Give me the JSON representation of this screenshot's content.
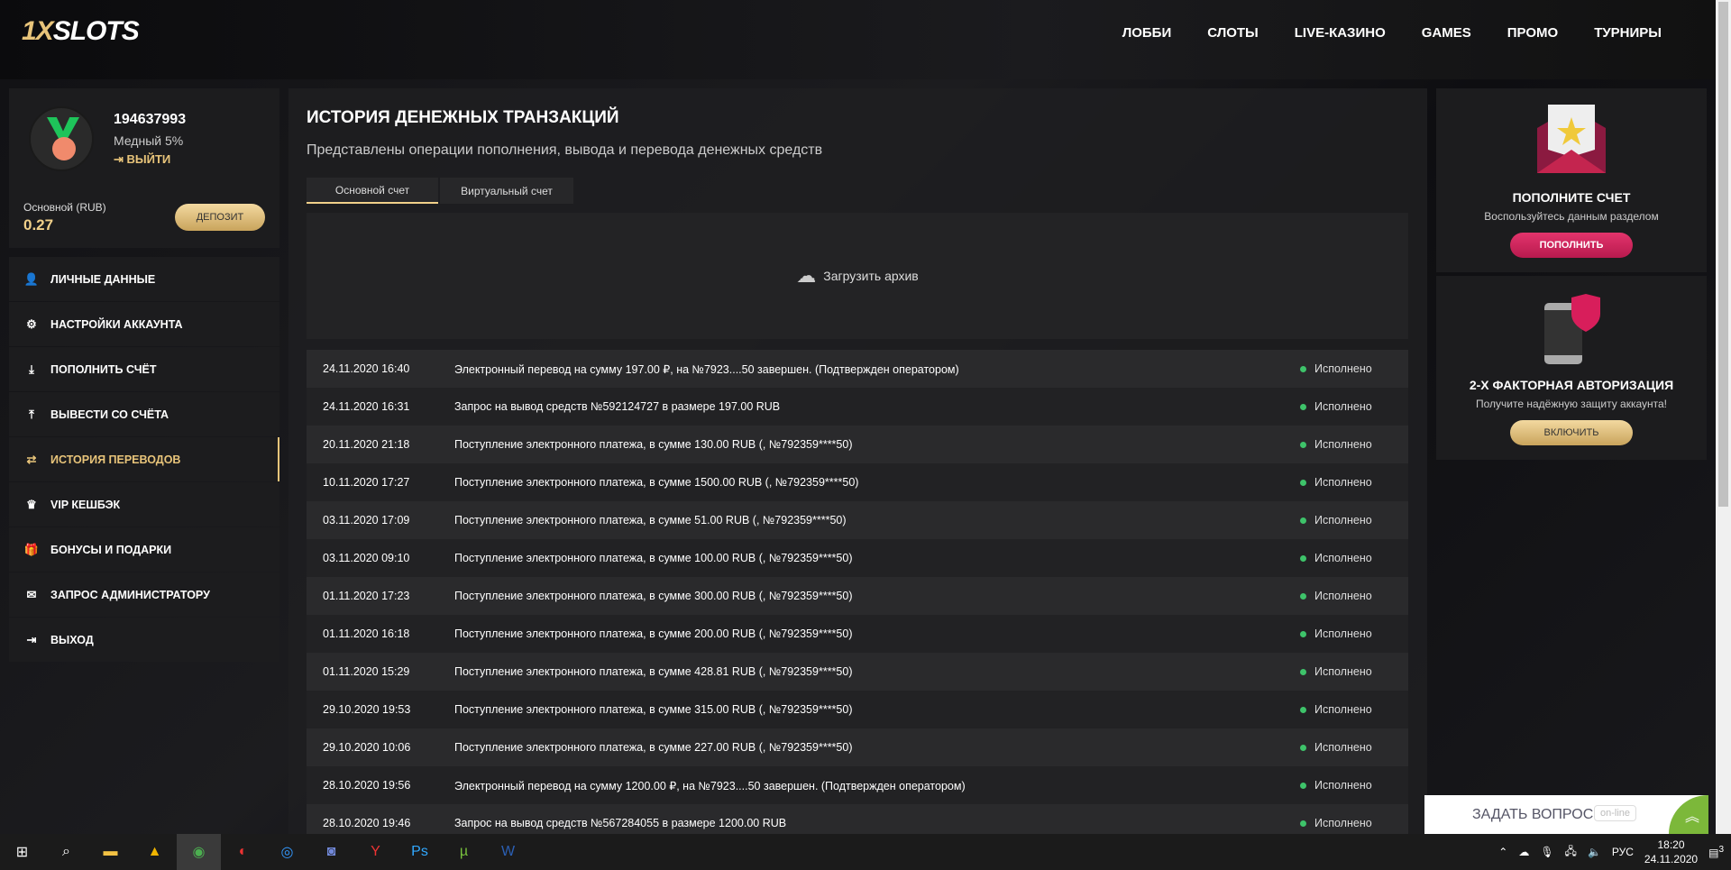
{
  "header": {
    "logo": "1XSLOTS",
    "nav": [
      "ЛОББИ",
      "СЛОТЫ",
      "LIVE-КАЗИНО",
      "GAMES",
      "ПРОМО",
      "ТУРНИРЫ"
    ]
  },
  "profile": {
    "id": "194637993",
    "rank": "Медный 5%",
    "logout": "ВЫЙТИ",
    "balance_label": "Основной (RUB)",
    "balance": "0.27",
    "deposit": "ДЕПОЗИТ"
  },
  "menu": [
    {
      "label": "ЛИЧНЫЕ ДАННЫЕ",
      "icon": "user-add-icon",
      "g": "👤"
    },
    {
      "label": "НАСТРОЙКИ АККАУНТА",
      "icon": "gears-icon",
      "g": "⚙"
    },
    {
      "label": "ПОПОЛНИТЬ СЧЁТ",
      "icon": "download-icon",
      "g": "⤓"
    },
    {
      "label": "ВЫВЕСТИ СО СЧЁТА",
      "icon": "upload-icon",
      "g": "⤒"
    },
    {
      "label": "ИСТОРИЯ ПЕРЕВОДОВ",
      "icon": "transfer-icon",
      "g": "⇄",
      "active": true
    },
    {
      "label": "VIP КЕШБЭК",
      "icon": "crown-icon",
      "g": "♛"
    },
    {
      "label": "БОНУСЫ И ПОДАРКИ",
      "icon": "gift-icon",
      "g": "🎁"
    },
    {
      "label": "ЗАПРОС АДМИНИСТРАТОРУ",
      "icon": "envelope-icon",
      "g": "✉"
    },
    {
      "label": "ВЫХОД",
      "icon": "sign-out-icon",
      "g": "⇥"
    }
  ],
  "main": {
    "title": "ИСТОРИЯ ДЕНЕЖНЫХ ТРАНЗАКЦИЙ",
    "subtitle": "Представлены операции пополнения, вывода и перевода денежных средств",
    "tabs": [
      "Основной счет",
      "Виртуальный счет"
    ],
    "archive": "Загрузить архив",
    "rows": [
      {
        "date": "24.11.2020 16:40",
        "text": "Электронный перевод на сумму 197.00 ₽, на №7923....50 завершен. (Подтвержден оператором)",
        "status": "Исполнено"
      },
      {
        "date": "24.11.2020 16:31",
        "text": "Запрос на вывод средств №592124727 в размере 197.00 RUB",
        "status": "Исполнено"
      },
      {
        "date": "20.11.2020 21:18",
        "text": "Поступление электронного платежа, в сумме 130.00 RUB (, №792359****50)",
        "status": "Исполнено"
      },
      {
        "date": "10.11.2020 17:27",
        "text": "Поступление электронного платежа, в сумме 1500.00 RUB (, №792359****50)",
        "status": "Исполнено"
      },
      {
        "date": "03.11.2020 17:09",
        "text": "Поступление электронного платежа, в сумме 51.00 RUB (, №792359****50)",
        "status": "Исполнено"
      },
      {
        "date": "03.11.2020 09:10",
        "text": "Поступление электронного платежа, в сумме 100.00 RUB (, №792359****50)",
        "status": "Исполнено"
      },
      {
        "date": "01.11.2020 17:23",
        "text": "Поступление электронного платежа, в сумме 300.00 RUB (, №792359****50)",
        "status": "Исполнено"
      },
      {
        "date": "01.11.2020 16:18",
        "text": "Поступление электронного платежа, в сумме 200.00 RUB (, №792359****50)",
        "status": "Исполнено"
      },
      {
        "date": "01.11.2020 15:29",
        "text": "Поступление электронного платежа, в сумме 428.81 RUB (, №792359****50)",
        "status": "Исполнено"
      },
      {
        "date": "29.10.2020 19:53",
        "text": "Поступление электронного платежа, в сумме 315.00 RUB (, №792359****50)",
        "status": "Исполнено"
      },
      {
        "date": "29.10.2020 10:06",
        "text": "Поступление электронного платежа, в сумме 227.00 RUB (, №792359****50)",
        "status": "Исполнено"
      },
      {
        "date": "28.10.2020 19:56",
        "text": "Электронный перевод на сумму 1200.00 ₽, на №7923....50 завершен. (Подтвержден оператором)",
        "status": "Исполнено"
      },
      {
        "date": "28.10.2020 19:46",
        "text": "Запрос на вывод средств №567284055 в размере 1200.00 RUB",
        "status": "Исполнено"
      }
    ]
  },
  "right": {
    "card1": {
      "title": "ПОПОЛНИТЕ СЧЕТ",
      "text": "Воспользуйтесь данным разделом",
      "button": "ПОПОЛНИТЬ"
    },
    "card2": {
      "title": "2-Х ФАКТОРНАЯ АВТОРИЗАЦИЯ",
      "text": "Получите надёжную защиту аккаунта!",
      "button": "ВКЛЮЧИТЬ"
    }
  },
  "chat": {
    "label": "ЗАДАТЬ ВОПРОС",
    "status": "on-line"
  },
  "taskbar": {
    "lang": "РУС",
    "time": "18:20",
    "date": "24.11.2020",
    "notifications": "3"
  }
}
